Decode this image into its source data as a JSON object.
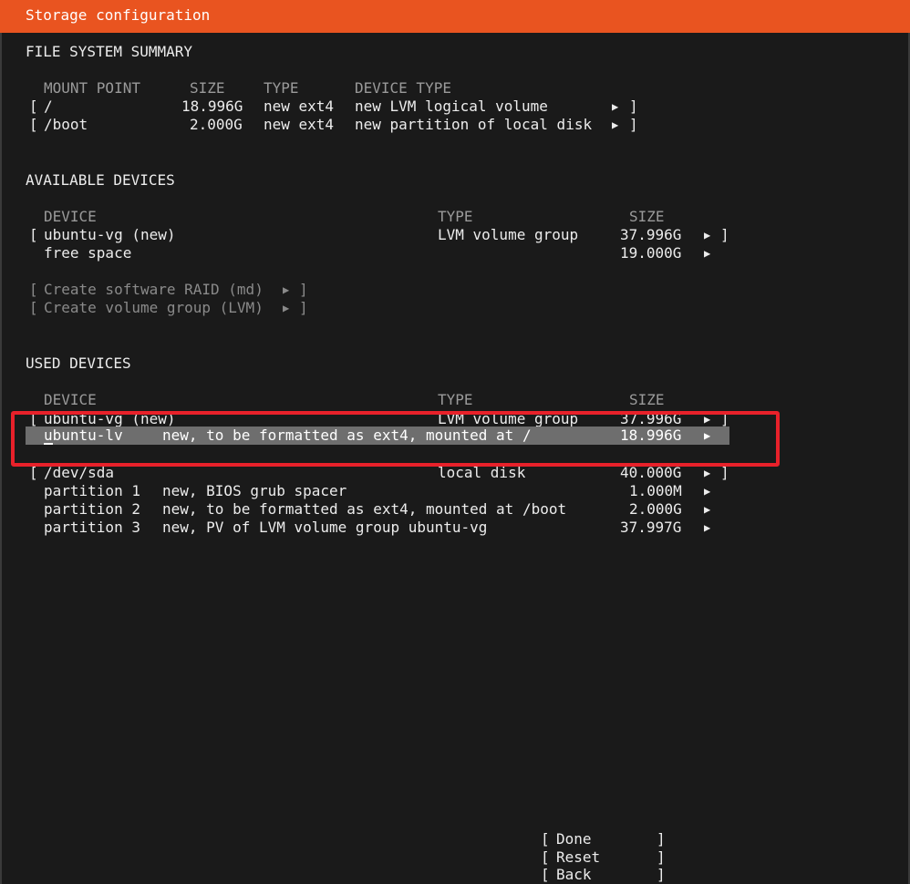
{
  "window": {
    "title": "Storage configuration",
    "accent_color": "#e95420",
    "highlight_color": "#e8212a"
  },
  "fs_summary": {
    "heading": "FILE SYSTEM SUMMARY",
    "headers": {
      "mount_point": "MOUNT POINT",
      "size": "SIZE",
      "type": "TYPE",
      "device_type": "DEVICE TYPE"
    },
    "rows": [
      {
        "mount": "/",
        "size": "18.996G",
        "type": "new ext4",
        "device_type": "new LVM logical volume"
      },
      {
        "mount": "/boot",
        "size": "2.000G",
        "type": "new ext4",
        "device_type": "new partition of local disk"
      }
    ]
  },
  "available": {
    "heading": "AVAILABLE DEVICES",
    "headers": {
      "device": "DEVICE",
      "type": "TYPE",
      "size": "SIZE"
    },
    "rows": [
      {
        "device": "ubuntu-vg (new)",
        "type": "LVM volume group",
        "size": "37.996G"
      },
      {
        "device": "free space",
        "type": "",
        "size": "19.000G"
      }
    ],
    "actions": [
      "Create software RAID (md)",
      "Create volume group (LVM)"
    ]
  },
  "used": {
    "heading": "USED DEVICES",
    "headers": {
      "device": "DEVICE",
      "type": "TYPE",
      "size": "SIZE"
    },
    "rows": [
      {
        "device": "ubuntu-vg (new)",
        "type": "LVM volume group",
        "size": "37.996G"
      },
      {
        "device": "ubuntu-lv",
        "type": "new, to be formatted as ext4, mounted at /",
        "size": "18.996G",
        "selected": true
      },
      {
        "device": "/dev/sda",
        "type": "local disk",
        "size": "40.000G"
      },
      {
        "device": "partition 1",
        "type": "new, BIOS grub spacer",
        "size": "1.000M"
      },
      {
        "device": "partition 2",
        "type": "new, to be formatted as ext4, mounted at /boot",
        "size": "2.000G"
      },
      {
        "device": "partition 3",
        "type": "new, PV of LVM volume group ubuntu-vg",
        "size": "37.997G"
      }
    ]
  },
  "buttons": {
    "done": "Done",
    "reset": "Reset",
    "back": "Back"
  },
  "glyphs": {
    "open_bracket": "[",
    "close_bracket": "]",
    "arrow": "▶"
  }
}
